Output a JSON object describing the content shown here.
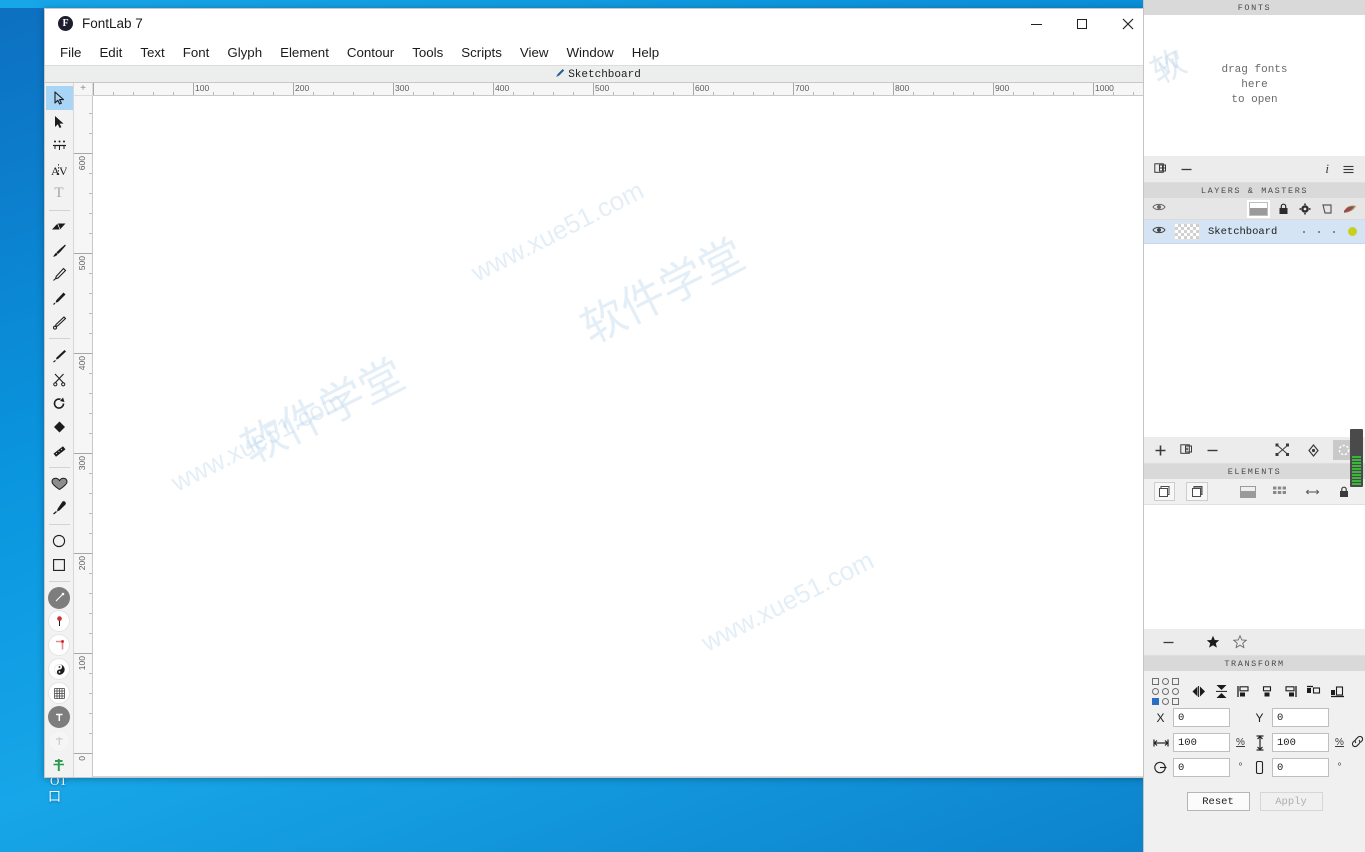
{
  "window": {
    "title": "FontLab 7",
    "logo_glyph": "F",
    "controls": {
      "minimize": "minimize-button",
      "maximize": "maximize-button",
      "close": "close-button"
    }
  },
  "menubar": {
    "items": [
      "File",
      "Edit",
      "Text",
      "Font",
      "Glyph",
      "Element",
      "Contour",
      "Tools",
      "Scripts",
      "View",
      "Window",
      "Help"
    ]
  },
  "tabstrip": {
    "active_tab": "Sketchboard"
  },
  "toolbar": {
    "groups": [
      {
        "tools": [
          {
            "name": "select-arrow-tool",
            "selected": true
          },
          {
            "name": "direct-select-tool",
            "selected": false
          },
          {
            "name": "measure-tool",
            "selected": false
          },
          {
            "name": "kerning-tool",
            "selected": false
          },
          {
            "name": "text-tool",
            "selected": false,
            "dim": true
          }
        ]
      },
      {
        "tools": [
          {
            "name": "eraser-tool",
            "selected": false
          },
          {
            "name": "brush-tool",
            "selected": false
          },
          {
            "name": "pen-tool",
            "selected": false
          },
          {
            "name": "rapid-pen-tool",
            "selected": false
          },
          {
            "name": "pencil-tool",
            "selected": false
          }
        ]
      },
      {
        "tools": [
          {
            "name": "knife-tool",
            "selected": false
          },
          {
            "name": "scissors-tool",
            "selected": false
          },
          {
            "name": "scale-tool",
            "selected": false
          },
          {
            "name": "paint-bucket-tool",
            "selected": false
          },
          {
            "name": "ruler-tool",
            "selected": false
          }
        ]
      },
      {
        "tools": [
          {
            "name": "shape-fill-tool",
            "selected": false
          },
          {
            "name": "eyedropper-tool",
            "selected": false
          }
        ]
      },
      {
        "tools": [
          {
            "name": "ellipse-tool",
            "selected": false
          },
          {
            "name": "rectangle-tool",
            "selected": false
          }
        ]
      },
      {
        "tools": [
          {
            "name": "power-guide-tool",
            "selected": false
          },
          {
            "name": "pin-tool",
            "selected": false
          },
          {
            "name": "corner-tool",
            "selected": false
          },
          {
            "name": "yin-yang-tool",
            "selected": false
          },
          {
            "name": "grid-tool",
            "selected": false
          },
          {
            "name": "anchor-tool",
            "selected": false
          },
          {
            "name": "ghost-tool",
            "selected": false
          },
          {
            "name": "plus-element-tool",
            "selected": false
          }
        ]
      }
    ]
  },
  "rulers": {
    "horizontal_labels": [
      "100",
      "200",
      "300",
      "400",
      "500",
      "600",
      "700",
      "800",
      "900",
      "1000"
    ],
    "vertical_labels": [
      "600",
      "500",
      "400",
      "300",
      "200",
      "100",
      "0"
    ],
    "corner_icon": "ruler-origin-icon"
  },
  "canvas": {
    "watermarks": [
      "www.xue51.com",
      "www.xue51.com",
      "www.xue51.com",
      "软件学堂",
      "软件学堂"
    ]
  },
  "dock": {
    "fonts": {
      "title": "FONTS",
      "drop_line1": "drag fonts",
      "drop_line2": "here",
      "drop_line3": "to open"
    },
    "layers": {
      "title": "LAYERS & MASTERS",
      "toolbar": [
        "duplicate-layer-icon",
        "remove-layer-icon",
        "info-icon",
        "menu-icon"
      ],
      "column_icons": [
        "layer-thumbnail-icon",
        "lock-icon",
        "gear-icon",
        "shape-icon",
        "color-swatch-icon"
      ],
      "rows": [
        {
          "name": "Sketchboard",
          "visible": true,
          "color": "#c9cf1e",
          "selected": true
        }
      ]
    },
    "elements": {
      "title": "ELEMENTS",
      "toolbar": [
        "add-icon",
        "duplicate-icon",
        "remove-icon",
        "transform-icon",
        "settings-icon",
        "selection-icon"
      ],
      "toolbar2": [
        "new-element-icon",
        "copy-element-icon",
        "thumbnail-view-icon",
        "grid-view-icon",
        "link-icon",
        "lock-icon"
      ]
    },
    "transform": {
      "title": "TRANSFORM",
      "toolbar": [
        "collapse-icon",
        "star-filled-icon",
        "star-outline-icon"
      ],
      "align_icons": [
        "flip-horizontal-icon",
        "flip-vertical-icon",
        "align-left-icon",
        "align-center-icon",
        "align-right-icon",
        "align-top-icon",
        "align-bottom-icon"
      ],
      "fields": {
        "x_label": "X",
        "x_value": "0",
        "y_label": "Y",
        "y_value": "0",
        "width_value": "100",
        "width_unit": "%",
        "height_value": "100",
        "height_unit": "%",
        "rotate_value": "0",
        "rotate_unit": "°",
        "slant_value": "0",
        "slant_unit": "°"
      },
      "anchor_selected": "bottom-left",
      "reset_label": "Reset",
      "apply_label": "Apply",
      "apply_disabled": true
    }
  },
  "desktop": {
    "icon_label_1": "OT",
    "icon_label_2": "口"
  },
  "colors": {
    "accent": "#2a6ec6",
    "selection": "#a8d4f5",
    "layer_row": "#d4e4f4",
    "layer_color": "#c9cf1e",
    "panel_header": "#d9d9d9",
    "slider_green": "#3cb53c"
  }
}
